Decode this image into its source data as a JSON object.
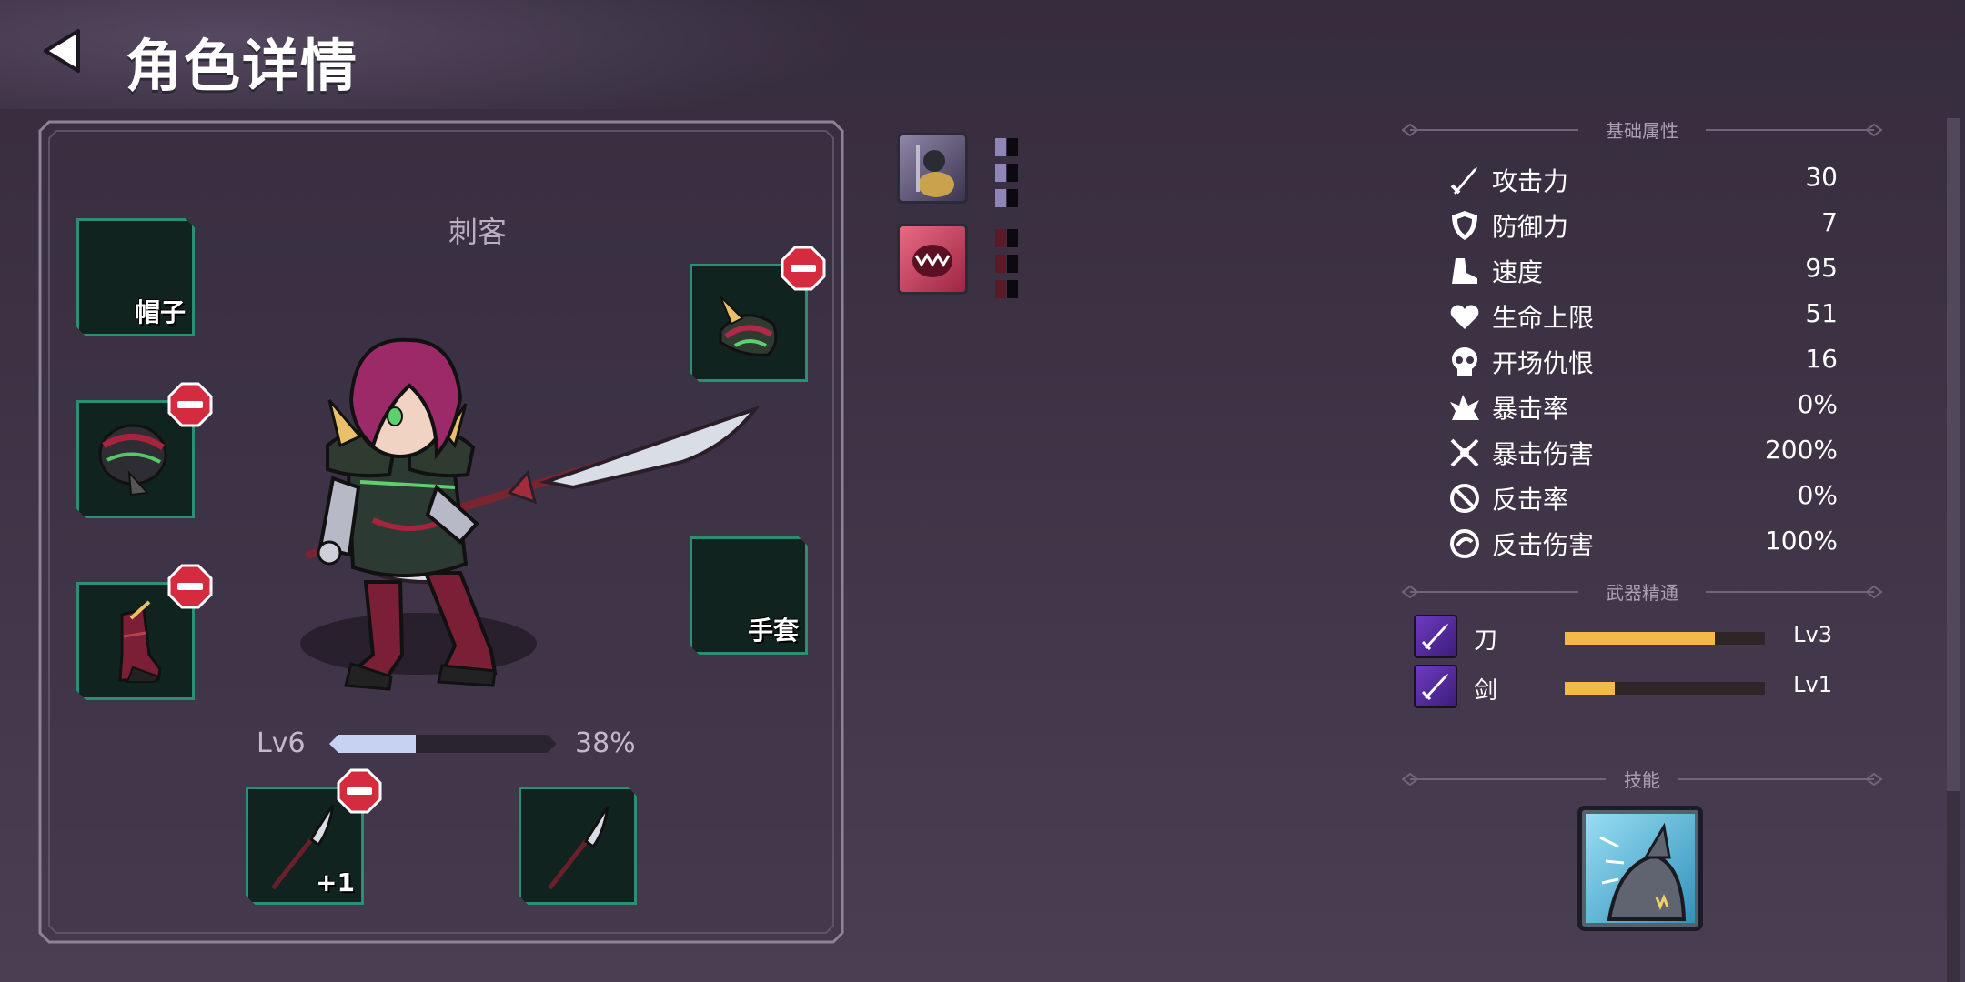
{
  "header": {
    "title": "角色详情"
  },
  "character": {
    "class_name": "刺客",
    "level_label": "Lv6",
    "level_progress": 0.38,
    "level_percent_text": "38%"
  },
  "equipment": {
    "hat_label": "帽子",
    "gloves_label": "手套",
    "weapon_bonus": "+1"
  },
  "base_stats": {
    "title": "基础属性",
    "items": [
      {
        "icon": "sword-icon",
        "label": "攻击力",
        "value": "30"
      },
      {
        "icon": "shield-icon",
        "label": "防御力",
        "value": "7"
      },
      {
        "icon": "boot-icon",
        "label": "速度",
        "value": "95"
      },
      {
        "icon": "heart-icon",
        "label": "生命上限",
        "value": "51"
      },
      {
        "icon": "skull-icon",
        "label": "开场仇恨",
        "value": "16"
      },
      {
        "icon": "burst-icon",
        "label": "暴击率",
        "value": "0%"
      },
      {
        "icon": "crossed-swords-icon",
        "label": "暴击伤害",
        "value": "200%"
      },
      {
        "icon": "counter-rate-icon",
        "label": "反击率",
        "value": "0%"
      },
      {
        "icon": "counter-damage-icon",
        "label": "反击伤害",
        "value": "100%"
      }
    ]
  },
  "weapon_mastery": {
    "title": "武器精通",
    "items": [
      {
        "name": "刀",
        "progress": 0.75,
        "level": "Lv3"
      },
      {
        "name": "剑",
        "progress": 0.25,
        "level": "Lv1"
      }
    ]
  },
  "skills": {
    "title": "技能"
  },
  "colors": {
    "slot_bg": "#11231e",
    "slot_border": "#2c8e72",
    "remove_badge": "#d52b3f",
    "level_fill": "#c7d2f2",
    "mastery_fill": "#f5b94a",
    "mastery_icon": "#6e3bc2"
  }
}
